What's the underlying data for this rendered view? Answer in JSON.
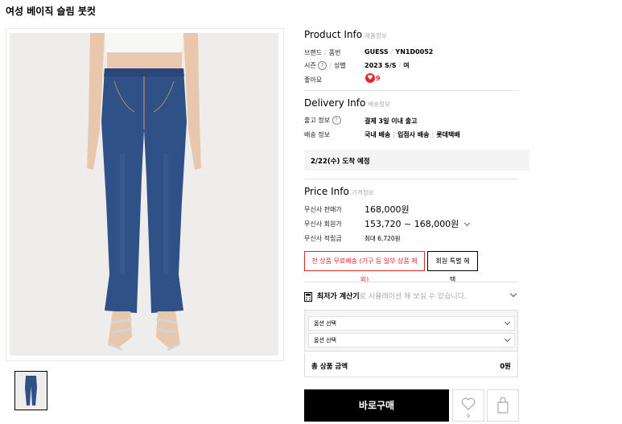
{
  "product": {
    "title": "여성 베이직 슬림 붓컷"
  },
  "info": {
    "title": "Product Info",
    "subtitle": "제품정보",
    "brand_label": "브랜드",
    "code_label": "품번",
    "brand": "GUESS",
    "code": "YN1D0052",
    "season_label": "시즌",
    "gender_label": "성별",
    "season": "2023 S/S",
    "gender": "여",
    "likes_label": "좋아요",
    "likes": "9"
  },
  "delivery": {
    "title": "Delivery Info",
    "subtitle": "배송정보",
    "ship_label": "출고 정보",
    "ship_value": "결제 3일 이내 출고",
    "method_label": "배송 정보",
    "method_1": "국내 배송",
    "method_2": "입점사 배송",
    "method_3": "롯데택배",
    "arrival": "2/22(수) 도착 예정"
  },
  "price": {
    "title": "Price Info",
    "subtitle": "가격정보",
    "sale_label": "무신사 판매가",
    "sale_value": "168,000원",
    "member_label": "무신사 회원가",
    "member_value": "153,720 ~ 168,000원",
    "points_label": "무신사 적립금",
    "points_value": "최대 6,720원",
    "free_ship_button": "전 상품 무료배송 (가구 등 일부 상품 제외)",
    "member_benefit_button": "회원 특별 혜택"
  },
  "calculator": {
    "label": "최저가 계산기",
    "desc": "로 시뮬레이션 해 보실 수 있습니다."
  },
  "options": {
    "select_1": "옵션 선택",
    "select_2": "옵션 선택"
  },
  "total": {
    "label": "총 상품 금액",
    "value": "0원"
  },
  "actions": {
    "buy_now": "바로구매",
    "wish_count": "9"
  },
  "colors": {
    "accent_red": "#e6262e",
    "denim": "#2d4f86"
  }
}
